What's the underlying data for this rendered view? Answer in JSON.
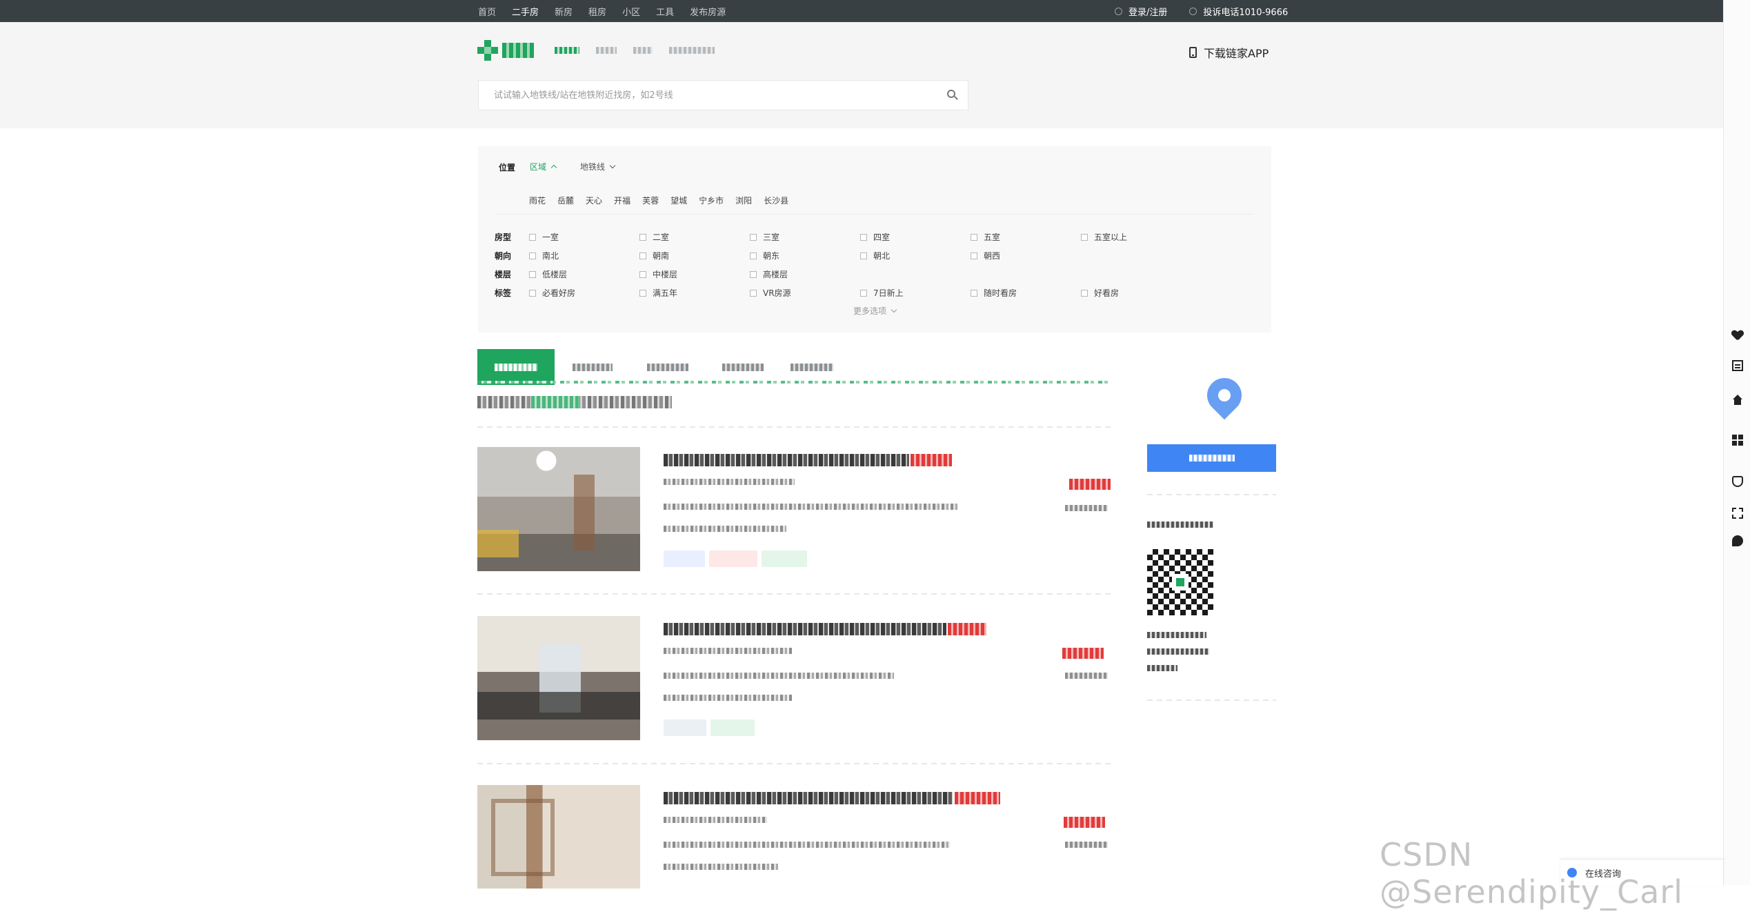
{
  "topnav": {
    "items": [
      "首页",
      "二手房",
      "新房",
      "租房",
      "小区",
      "工具",
      "发布房源"
    ],
    "active_index": 1,
    "login": "登录/注册",
    "hotline": "投诉电话1010-9666"
  },
  "header": {
    "download_app": "下载链家APP",
    "search_placeholder": "试试输入地铁线/站在地铁附近找房，如2号线"
  },
  "filter": {
    "location_label": "位置",
    "location_tabs": [
      "区域",
      "地铁线"
    ],
    "districts": [
      "雨花",
      "岳麓",
      "天心",
      "开福",
      "芙蓉",
      "望城",
      "宁乡市",
      "浏阳",
      "长沙县"
    ],
    "rows": [
      {
        "label": "房型",
        "options": [
          "一室",
          "二室",
          "三室",
          "四室",
          "五室",
          "五室以上"
        ]
      },
      {
        "label": "朝向",
        "options": [
          "南北",
          "朝南",
          "朝东",
          "朝北",
          "朝西"
        ]
      },
      {
        "label": "楼层",
        "options": [
          "低楼层",
          "中楼层",
          "高楼层"
        ]
      },
      {
        "label": "标签",
        "options": [
          "必看好房",
          "满五年",
          "VR房源",
          "7日新上",
          "随时看房",
          "好看房"
        ]
      }
    ],
    "more": "更多选项"
  },
  "consult": "在线咨询",
  "watermark": "CSDN @Serendipity_Carl",
  "colors": {
    "topbar": "#394043",
    "brand_green": "#1fa55d",
    "accent_blue": "#3f86f4",
    "price_red": "#e23b3b"
  }
}
